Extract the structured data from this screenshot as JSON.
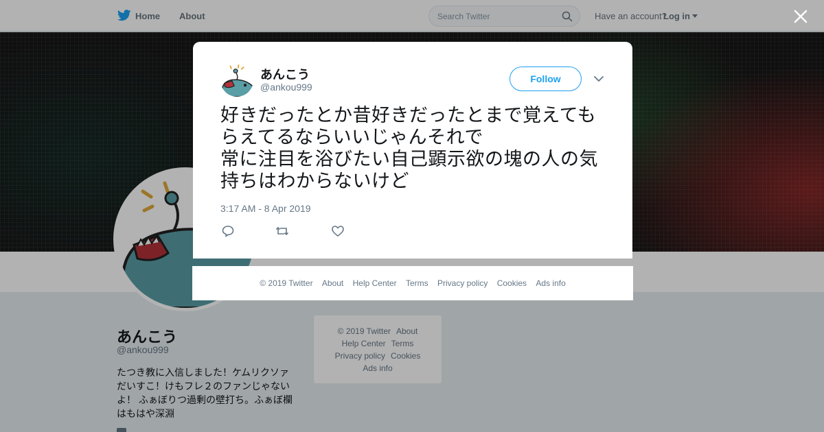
{
  "topbar": {
    "home_label": "Home",
    "about_label": "About",
    "search_placeholder": "Search Twitter",
    "have_account_label": "Have an account?",
    "login_label": "Log in"
  },
  "profile": {
    "name": "あんこう",
    "handle": "@ankou999",
    "bio": "たつき教に入信しました！ケムリクソァだいすこ！けもフレ２のファンじゃないよ！ ふぁぼりつ過剰の壁打ち。ふぁぼ欄はもはや深淵"
  },
  "side_footer": {
    "copyright": "© 2019 Twitter",
    "about": "About",
    "help_center": "Help Center",
    "terms": "Terms",
    "privacy": "Privacy policy",
    "cookies": "Cookies",
    "ads_info": "Ads info"
  },
  "tweet": {
    "name": "あんこう",
    "handle": "@ankou999",
    "follow_label": "Follow",
    "text": "好きだったとか昔好きだったとまで覚えてもらえてるならいいじゃんそれで\n常に注目を浴びたい自己顕示欲の塊の人の気持ちはわからないけど",
    "timestamp": "3:17 AM - 8 Apr 2019"
  },
  "modal_footer": {
    "copyright": "© 2019 Twitter",
    "about": "About",
    "help_center": "Help Center",
    "terms": "Terms",
    "privacy": "Privacy policy",
    "cookies": "Cookies",
    "ads_info": "Ads info"
  },
  "colors": {
    "accent": "#1da1f2",
    "avatar_fish": "#5a9ea6",
    "secondary_text": "#657786"
  },
  "icons": [
    "twitter-bird-icon",
    "search-icon",
    "caret-down-icon",
    "close-icon",
    "chevron-down-icon",
    "reply-icon",
    "retweet-icon",
    "like-icon"
  ]
}
